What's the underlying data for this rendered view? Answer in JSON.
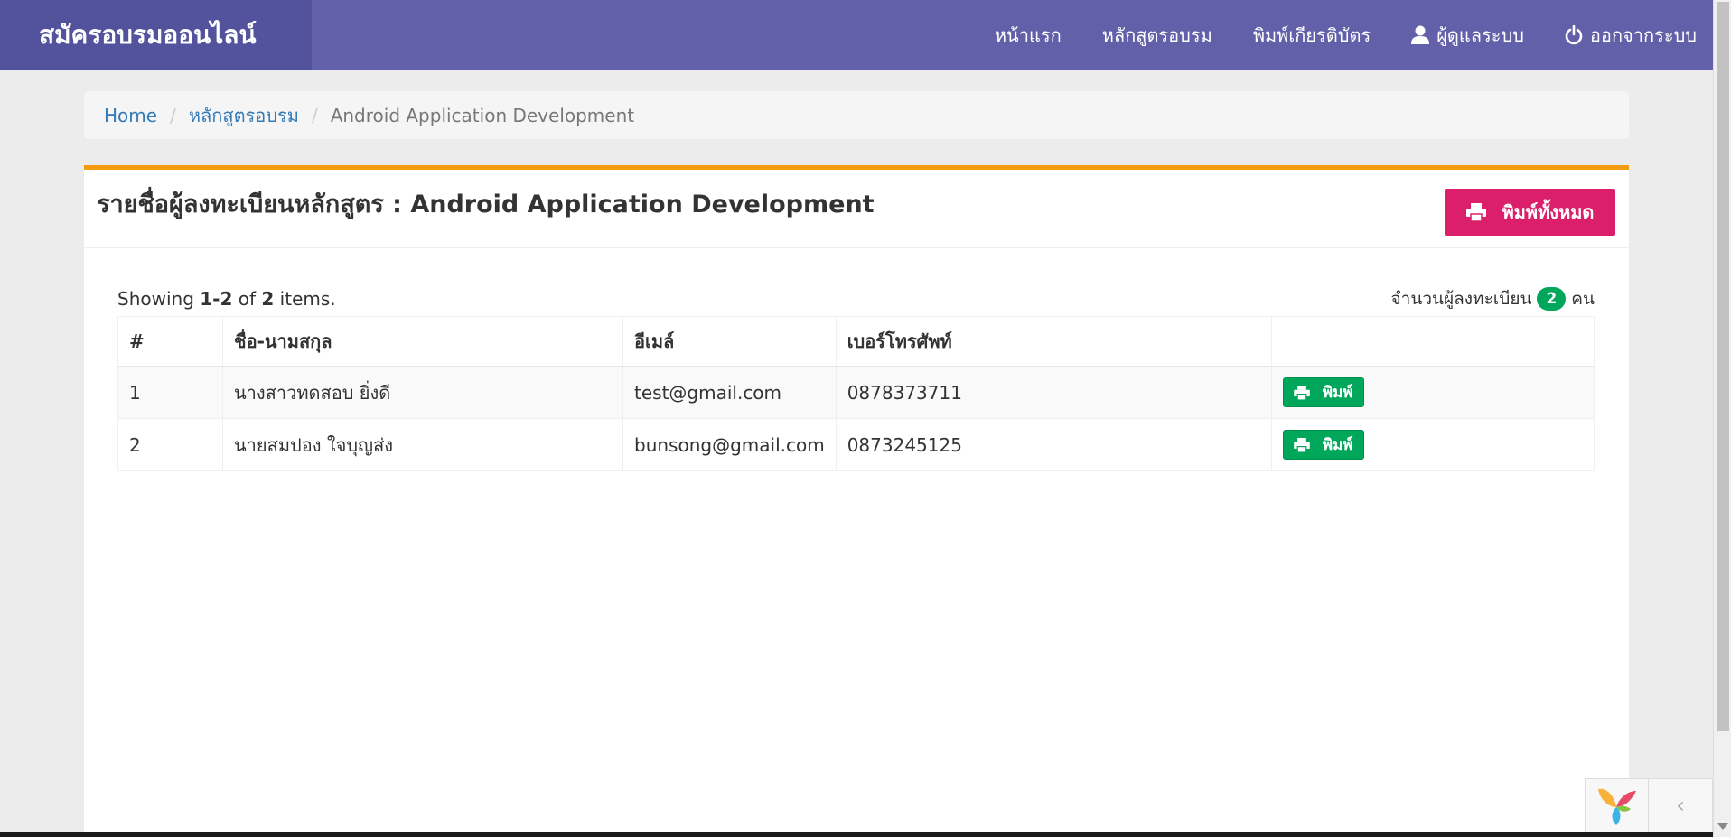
{
  "navbar": {
    "brand": "สมัครอบรมออนไลน์",
    "items": [
      {
        "label": "หน้าแรก",
        "icon": ""
      },
      {
        "label": "หลักสูตรอบรม",
        "icon": ""
      },
      {
        "label": "พิมพ์เกียรติบัตร",
        "icon": ""
      },
      {
        "label": "ผู้ดูแลระบบ",
        "icon": "user-icon"
      },
      {
        "label": "ออกจากระบบ",
        "icon": "power-icon"
      }
    ]
  },
  "breadcrumb": {
    "home": "Home",
    "courses": "หลักสูตรอบรม",
    "current": "Android Application Development",
    "separator": "/"
  },
  "panel": {
    "title": "รายชื่อผู้ลงทะเบียนหลักสูตร : Android Application Development",
    "print_all_label": "พิมพ์ทั้งหมด"
  },
  "summary": {
    "showing_prefix": "Showing ",
    "range": "1-2",
    "of": " of ",
    "total": "2",
    "items_suffix": " items.",
    "registrant_label": "จำนวนผู้ลงทะเบียน",
    "registrant_count": "2",
    "unit": "คน"
  },
  "table": {
    "headers": [
      "#",
      "ชื่อ-นามสกุล",
      "อีเมล์",
      "เบอร์โทรศัพท์",
      ""
    ],
    "rows": [
      {
        "no": "1",
        "name": "นางสาวทดสอบ ยิ่งดี",
        "email": "test@gmail.com",
        "phone": "0878373711",
        "action": "พิมพ์"
      },
      {
        "no": "2",
        "name": "นายสมปอง ใจบุญส่ง",
        "email": "bunsong@gmail.com",
        "phone": "0873245125",
        "action": "พิมพ์"
      }
    ]
  },
  "colors": {
    "navbar": "#6160a9",
    "brand_bg": "#53529c",
    "panel_accent": "#f39c12",
    "print_all": "#dc1f6b",
    "print_row": "#00a65a",
    "link": "#337ab7"
  }
}
